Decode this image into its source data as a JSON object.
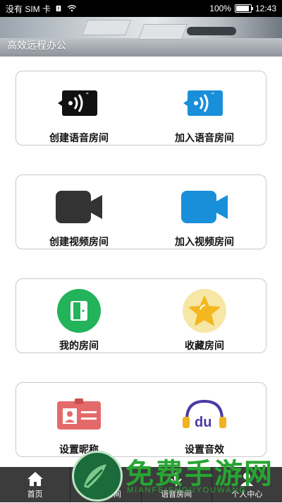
{
  "status_bar": {
    "carrier": "没有 SIM 卡",
    "battery_text": "100%",
    "battery_level": 1.0,
    "time": "12:43"
  },
  "banner": {
    "title": "高效远程办公"
  },
  "cards": [
    {
      "left_label": "创建语音房间",
      "right_label": "加入语音房间"
    },
    {
      "left_label": "创建视频房间",
      "right_label": "加入视频房间"
    },
    {
      "left_label": "我的房间",
      "right_label": "收藏房间"
    },
    {
      "left_label": "设置昵称",
      "right_label": "设置音效"
    }
  ],
  "tabbar": {
    "tabs": [
      {
        "label": "首页",
        "icon": "home-icon"
      },
      {
        "label": "视频房间",
        "icon": "video-room-icon"
      },
      {
        "label": "语音房间",
        "icon": "voice-room-icon"
      },
      {
        "label": "个人中心",
        "icon": "person-icon"
      }
    ]
  },
  "watermark": {
    "text": "免费手游网",
    "sub": "MIANFEISHOUYOUWANG"
  },
  "colors": {
    "black_icon": "#111111",
    "blue_icon": "#1a8fd9",
    "green_icon": "#22b35b",
    "star_bg": "#f7e7a6",
    "badge_red": "#e46a6a",
    "audio_purple": "#4c3aa6",
    "audio_yellow": "#f0b41d"
  }
}
